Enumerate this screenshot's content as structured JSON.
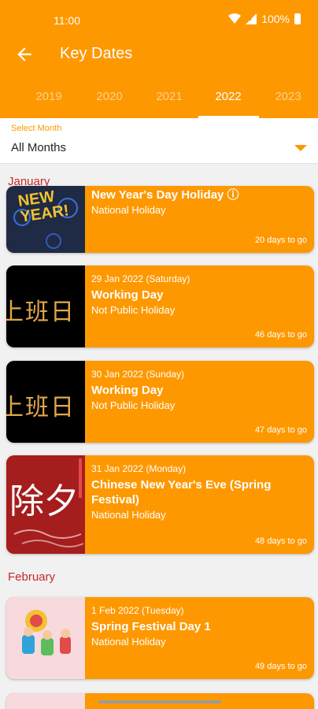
{
  "status": {
    "time": "11:00",
    "battery": "100%"
  },
  "appbar": {
    "title": "Key Dates",
    "back_icon": "arrow-back-icon"
  },
  "tabs": [
    {
      "label": "2019",
      "active": false
    },
    {
      "label": "2020",
      "active": false
    },
    {
      "label": "2021",
      "active": false
    },
    {
      "label": "2022",
      "active": true
    },
    {
      "label": "2023",
      "active": false
    }
  ],
  "select": {
    "label": "Select Month",
    "value": "All Months"
  },
  "months": {
    "january": "January",
    "february": "February"
  },
  "cards": [
    {
      "date": "",
      "name": "New Year's Day Holiday ⓘ",
      "type": "National Holiday",
      "days": "20 days to go",
      "thumb_text": "NEW YEAR!"
    },
    {
      "date": "29 Jan 2022 (Saturday)",
      "name": "Working Day",
      "type": "Not Public Holiday",
      "days": "46 days to go",
      "thumb_text": "上班日"
    },
    {
      "date": "30 Jan 2022 (Sunday)",
      "name": "Working Day",
      "type": "Not Public Holiday",
      "days": "47 days to go",
      "thumb_text": "上班日"
    },
    {
      "date": "31 Jan 2022 (Monday)",
      "name": "Chinese New Year's Eve (Spring Festival)",
      "type": "National Holiday",
      "days": "48 days to go",
      "thumb_text": "除夕"
    },
    {
      "date": "1 Feb 2022 (Tuesday)",
      "name": "Spring Festival Day 1",
      "type": "National Holiday",
      "days": "49 days to go"
    }
  ],
  "colors": {
    "accent": "#fe9800",
    "month_header": "#c62828"
  }
}
